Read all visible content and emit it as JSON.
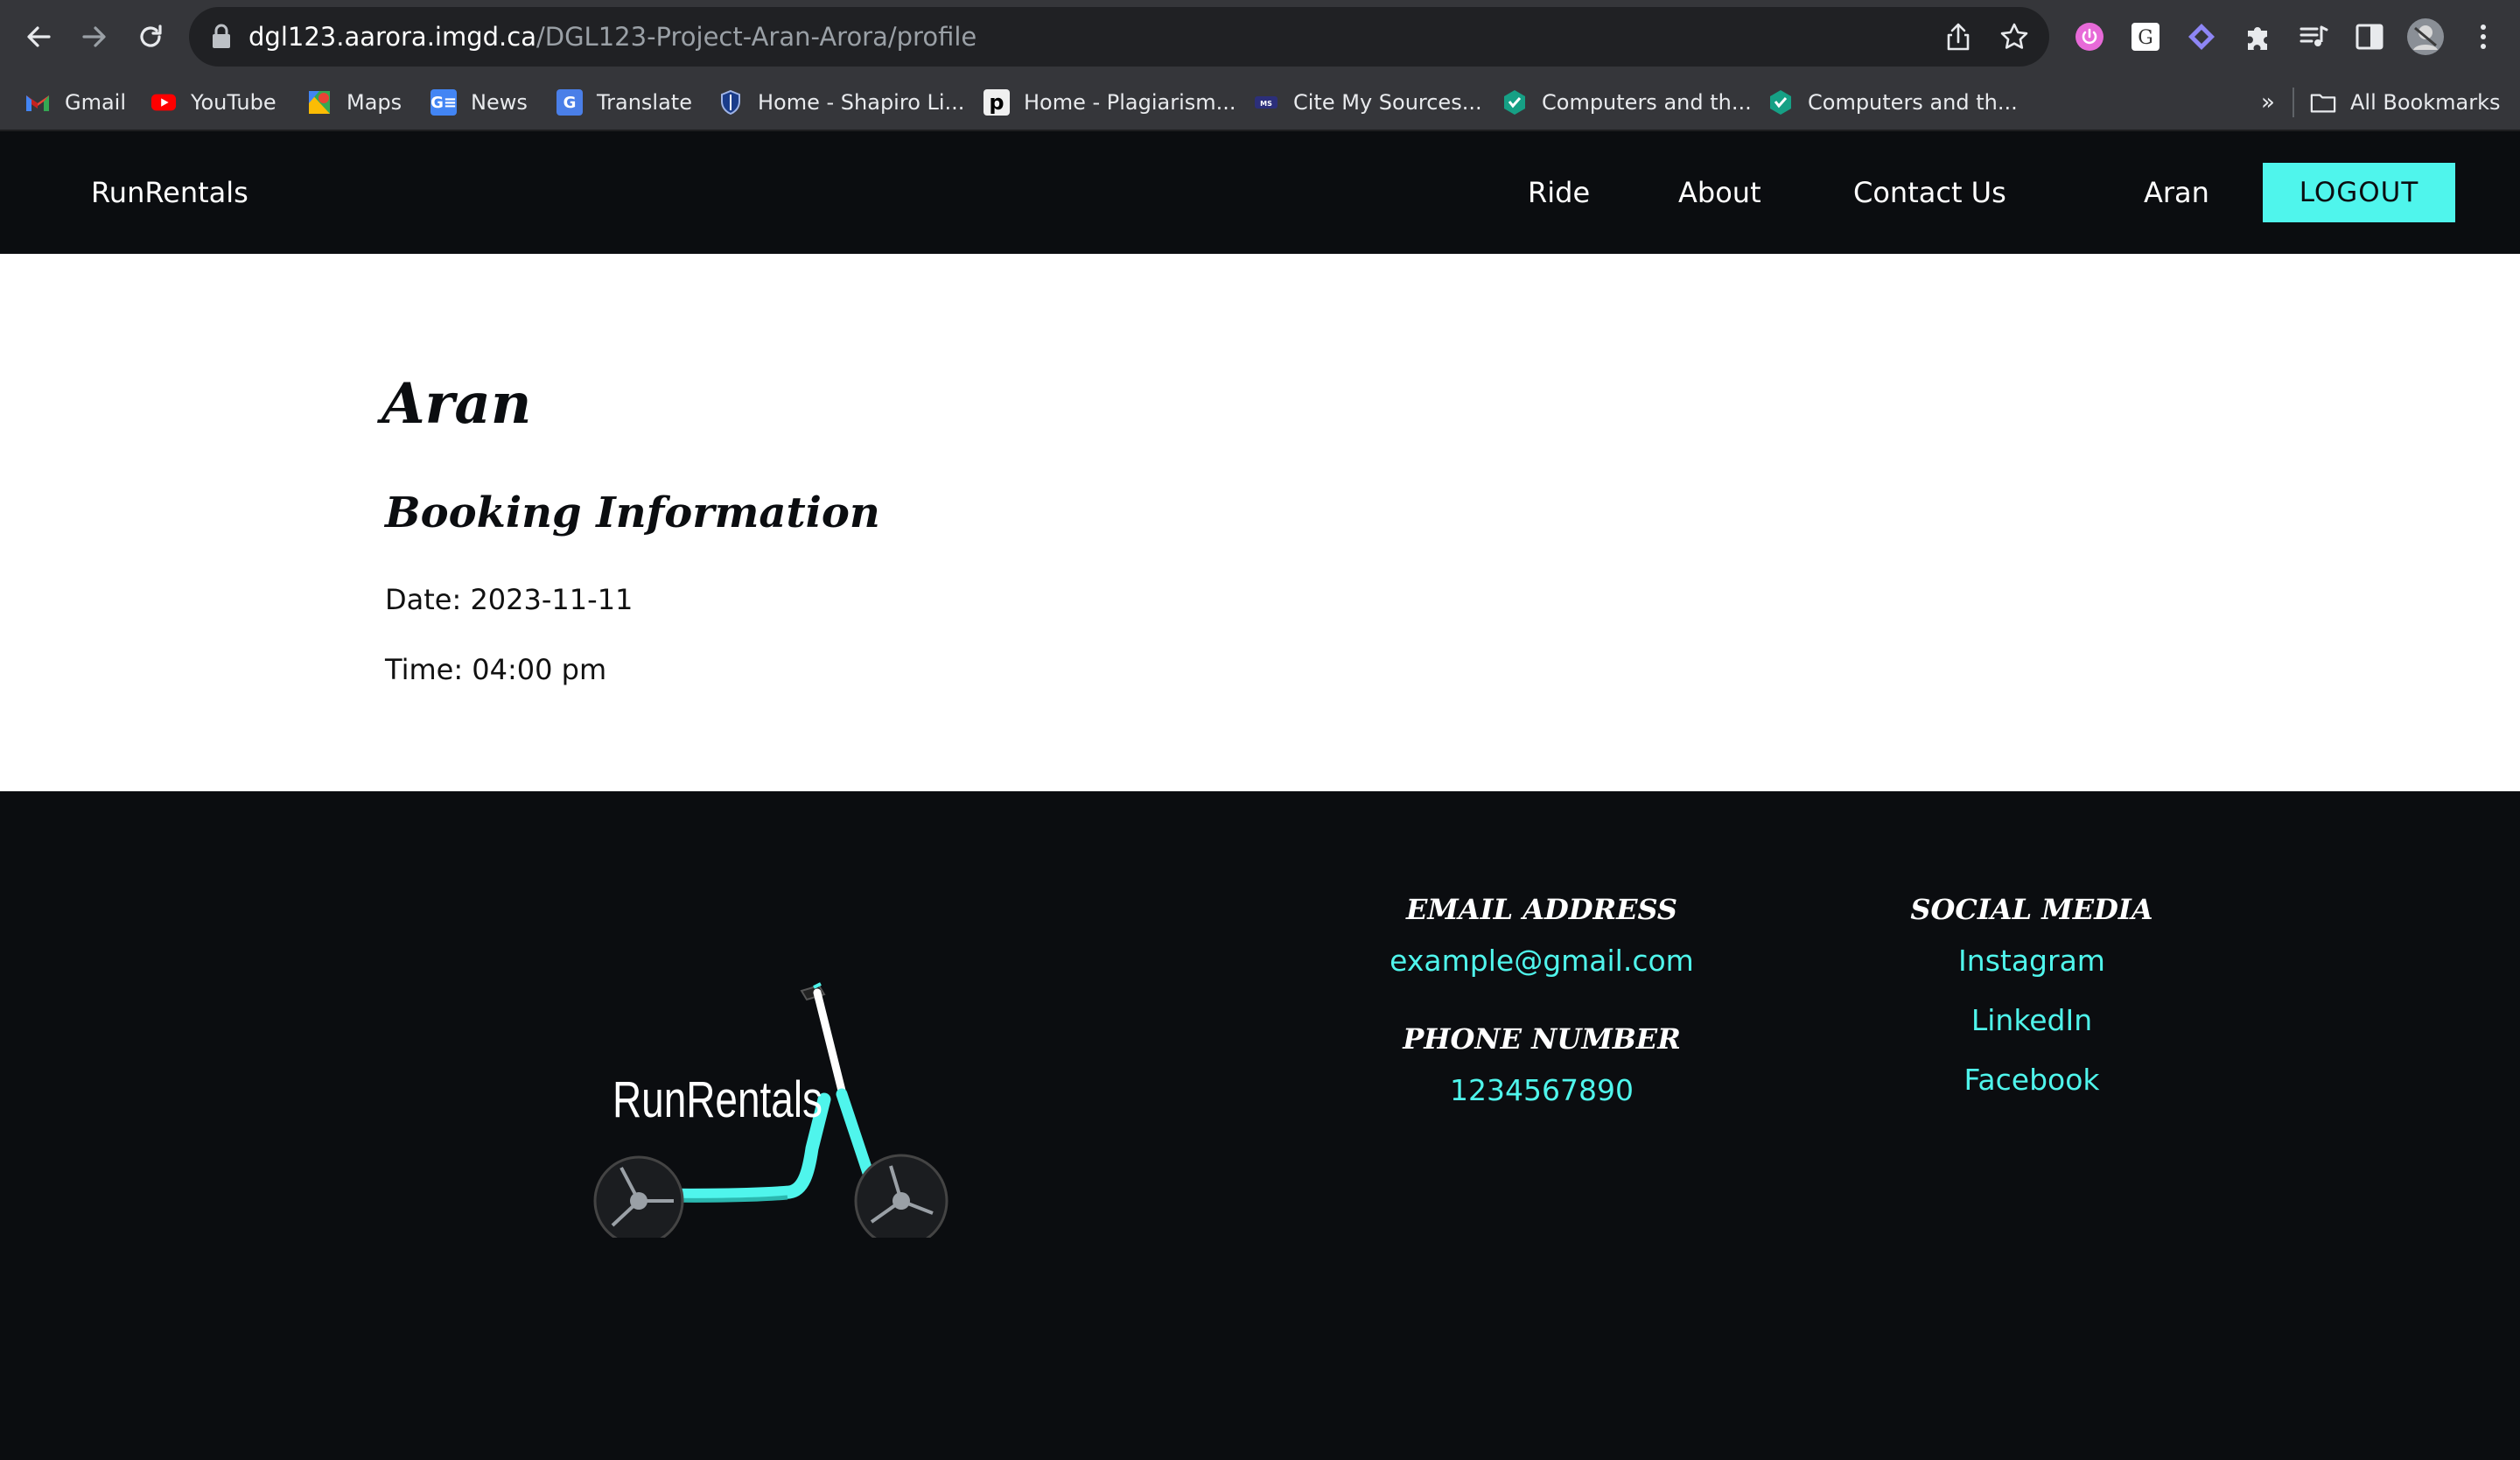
{
  "browser": {
    "url_host": "dgl123.aarora.imgd.ca",
    "url_path": "/DGL123-Project-Aran-Arora/profile",
    "bookmarks": [
      {
        "label": "Gmail"
      },
      {
        "label": "YouTube"
      },
      {
        "label": "Maps"
      },
      {
        "label": "News"
      },
      {
        "label": "Translate"
      },
      {
        "label": "Home - Shapiro Li..."
      },
      {
        "label": "Home - Plagiarism..."
      },
      {
        "label": "Cite My Sources..."
      },
      {
        "label": "Computers and th..."
      },
      {
        "label": "Computers and th..."
      }
    ],
    "more_bookmarks": "»",
    "all_bookmarks": "All Bookmarks"
  },
  "nav": {
    "brand": "RunRentals",
    "links": [
      "Ride",
      "About",
      "Contact Us"
    ],
    "user": "Aran",
    "logout": "LOGOUT"
  },
  "profile": {
    "name": "Aran",
    "booking_heading": "Booking Information",
    "date_line": "Date: 2023-11-11",
    "time_line": "Time: 04:00 pm"
  },
  "footer": {
    "logo_text": "RunRentals",
    "email_heading": "EMAIL ADDRESS",
    "email": "example@gmail.com",
    "phone_heading": "PHONE NUMBER",
    "phone": "1234567890",
    "social_heading": "SOCIAL MEDIA",
    "social_links": [
      "Instagram",
      "LinkedIn",
      "Facebook"
    ]
  },
  "colors": {
    "accent": "#4ff5ec",
    "dark_bg": "#0b0d10",
    "chrome_bg": "#35363a"
  }
}
